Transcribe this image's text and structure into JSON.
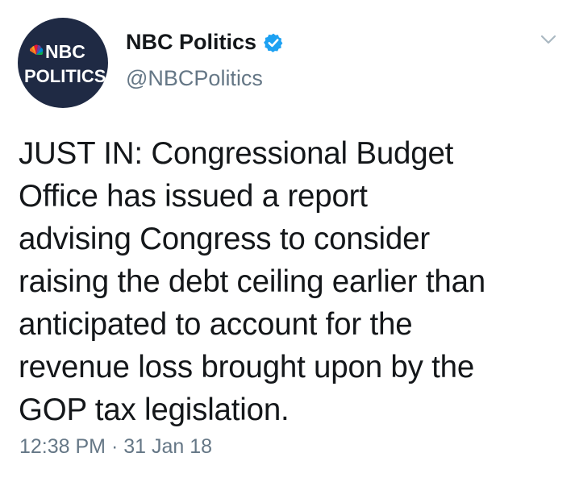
{
  "author": {
    "name": "NBC Politics",
    "handle": "@NBCPolitics",
    "verified": true,
    "avatar_logo": {
      "line1": "NBC",
      "line2": "POLITICS"
    }
  },
  "tweet": {
    "text": "JUST IN: Congressional Budget\nOffice has issued a report\nadvising Congress to consider\nraising the debt ceiling earlier than\nanticipated to account for the\nrevenue loss brought upon by the\nGOP tax legislation.",
    "time": "12:38 PM",
    "separator": " · ",
    "date": "31 Jan 18"
  },
  "icons": {
    "verified": "verified-badge-icon",
    "more": "chevron-down-icon"
  },
  "colors": {
    "verified": "#1da1f2",
    "secondary_text": "#657786",
    "avatar_bg": "#1f2a44"
  }
}
